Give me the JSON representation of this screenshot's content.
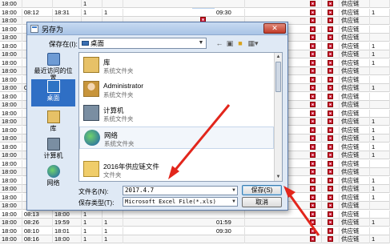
{
  "sheet": {
    "rows": [
      {
        "time": "18:00",
        "in": "",
        "out": "",
        "n1": "1",
        "n2": "",
        "out2": "",
        "sup": "供应链",
        "n3": ""
      },
      {
        "time": "18:00",
        "in": "08:12",
        "out": "18:31",
        "n1": "1",
        "n2": "1",
        "out2": "09:30",
        "sup": "供应链",
        "n3": "1"
      },
      {
        "time": "18:00",
        "in": "",
        "out": "",
        "n1": "",
        "n2": "",
        "out2": "",
        "sup": "供应链",
        "n3": ""
      },
      {
        "time": "18:00",
        "in": "",
        "out": "",
        "n1": "",
        "n2": "",
        "out2": "",
        "sup": "供应链",
        "n3": ""
      },
      {
        "time": "18:00",
        "in": "",
        "out": "",
        "n1": "",
        "n2": "",
        "out2": "",
        "sup": "供应链",
        "n3": ""
      },
      {
        "time": "18:00",
        "in": "",
        "out": "",
        "n1": "",
        "n2": "",
        "out2": "",
        "sup": "供应链",
        "n3": "1"
      },
      {
        "time": "18:00",
        "in": "",
        "out": "",
        "n1": "",
        "n2": "",
        "out2": "",
        "sup": "供应链",
        "n3": "1"
      },
      {
        "time": "18:00",
        "in": "",
        "out": "",
        "n1": "",
        "n2": "",
        "out2": "",
        "sup": "供应链",
        "n3": "1"
      },
      {
        "time": "18:00",
        "in": "",
        "out": "",
        "n1": "",
        "n2": "",
        "out2": "",
        "sup": "供应链",
        "n3": ""
      },
      {
        "time": "18:00",
        "in": "",
        "out": "",
        "n1": "",
        "n2": "",
        "out2": "",
        "sup": "供应链",
        "n3": ""
      },
      {
        "time": "18:00",
        "in": "08",
        "out": "",
        "n1": "",
        "n2": "",
        "out2": "",
        "sup": "供应链",
        "n3": "1"
      },
      {
        "time": "18:00",
        "in": "",
        "out": "",
        "n1": "",
        "n2": "",
        "out2": "",
        "sup": "供应链",
        "n3": ""
      },
      {
        "time": "18:00",
        "in": "",
        "out": "",
        "n1": "",
        "n2": "",
        "out2": "",
        "sup": "供应链",
        "n3": ""
      },
      {
        "time": "18:00",
        "in": "",
        "out": "",
        "n1": "",
        "n2": "",
        "out2": "",
        "sup": "供应链",
        "n3": ""
      },
      {
        "time": "18:00",
        "in": "",
        "out": "",
        "n1": "",
        "n2": "",
        "out2": "",
        "sup": "供应链",
        "n3": "1"
      },
      {
        "time": "18:00",
        "in": "",
        "out": "",
        "n1": "",
        "n2": "",
        "out2": "",
        "sup": "供应链",
        "n3": "1"
      },
      {
        "time": "18:00",
        "in": "",
        "out": "",
        "n1": "",
        "n2": "",
        "out2": "",
        "sup": "供应链",
        "n3": "1"
      },
      {
        "time": "18:00",
        "in": "",
        "out": "",
        "n1": "",
        "n2": "",
        "out2": "",
        "sup": "供应链",
        "n3": "1"
      },
      {
        "time": "18:00",
        "in": "",
        "out": "",
        "n1": "",
        "n2": "",
        "out2": "",
        "sup": "供应链",
        "n3": "1"
      },
      {
        "time": "18:00",
        "in": "",
        "out": "",
        "n1": "",
        "n2": "",
        "out2": "",
        "sup": "供应链",
        "n3": ""
      },
      {
        "time": "18:00",
        "in": "",
        "out": "",
        "n1": "",
        "n2": "",
        "out2": "",
        "sup": "供应链",
        "n3": ""
      },
      {
        "time": "18:00",
        "in": "",
        "out": "",
        "n1": "",
        "n2": "",
        "out2": "",
        "sup": "供应链",
        "n3": "1"
      },
      {
        "time": "18:00",
        "in": "",
        "out": "",
        "n1": "",
        "n2": "",
        "out2": "",
        "sup": "供应链",
        "n3": "1"
      },
      {
        "time": "18:00",
        "in": "",
        "out": "",
        "n1": "",
        "n2": "",
        "out2": "",
        "sup": "供应链",
        "n3": "1"
      },
      {
        "time": "18:00",
        "in": "",
        "out": "",
        "n1": "",
        "n2": "",
        "out2": "",
        "sup": "供应链",
        "n3": ""
      },
      {
        "time": "18:00",
        "in": "08:13",
        "out": "18:00",
        "n1": "1",
        "n2": "",
        "out2": "",
        "sup": "供应链",
        "n3": ""
      },
      {
        "time": "18:00",
        "in": "08:26",
        "out": "19:59",
        "n1": "1",
        "n2": "1",
        "out2": "01:59",
        "sup": "供应链",
        "n3": "1"
      },
      {
        "time": "18:00",
        "in": "08:10",
        "out": "18:01",
        "n1": "1",
        "n2": "1",
        "out2": "09:30",
        "sup": "供应链",
        "n3": ""
      },
      {
        "time": "18:00",
        "in": "08:16",
        "out": "18:00",
        "n1": "1",
        "n2": "1",
        "out2": "",
        "sup": "供应链",
        "n3": "1"
      }
    ]
  },
  "dialog": {
    "title": "另存为",
    "close_glyph": "✕",
    "save_in_label": "保存在(I):",
    "save_in_value": "桌面",
    "places": [
      {
        "label": "最近访问的位置",
        "icon": "recent-places-icon",
        "selected": false
      },
      {
        "label": "桌面",
        "icon": "desktop-icon",
        "selected": true
      },
      {
        "label": "库",
        "icon": "library-icon",
        "selected": false
      },
      {
        "label": "计算机",
        "icon": "computer-icon",
        "selected": false
      },
      {
        "label": "网络",
        "icon": "network-icon",
        "selected": false
      }
    ],
    "files": [
      {
        "name": "库",
        "type": "系统文件夹",
        "icon": "library-folder-icon"
      },
      {
        "name": "Administrator",
        "type": "系统文件夹",
        "icon": "user-folder-icon"
      },
      {
        "name": "计算机",
        "type": "系统文件夹",
        "icon": "computer-icon"
      },
      {
        "name": "网络",
        "type": "系统文件夹",
        "icon": "network-icon"
      },
      {
        "name": "2016年供应链文件",
        "type": "文件夹",
        "icon": "folder-icon"
      }
    ],
    "filename_label": "文件名(N):",
    "filename_value": "2017.4.7",
    "filetype_label": "保存类型(T):",
    "filetype_value": "Microsoft Excel File(*.xls)",
    "save_button": "保存(S)",
    "cancel_button": "取消",
    "annotation_color": "#e2261c"
  }
}
